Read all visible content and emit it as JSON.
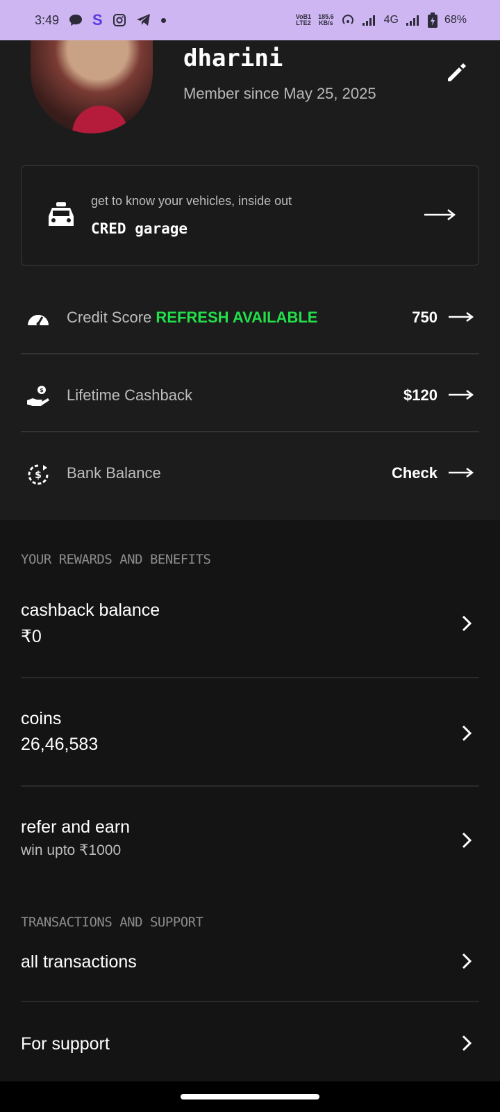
{
  "status": {
    "time": "3:49",
    "volte": "VoB1\nLTE2",
    "speed": "185.6\nKB/s",
    "network": "4G",
    "battery": "68%"
  },
  "profile": {
    "name": "dharini",
    "member_since": "Member since May 25, 2025"
  },
  "garage": {
    "subtitle": "get to know your vehicles, inside out",
    "title": "CRED garage"
  },
  "stats": [
    {
      "label": "Credit Score",
      "tag": "REFRESH AVAILABLE",
      "value": "750"
    },
    {
      "label": "Lifetime Cashback",
      "value": "$120"
    },
    {
      "label": "Bank Balance",
      "value": "Check"
    }
  ],
  "rewards": {
    "heading": "YOUR REWARDS AND BENEFITS",
    "cashback_title": "cashback balance",
    "cashback_value": "₹0",
    "coins_title": "coins",
    "coins_value": "26,46,583",
    "refer_title": "refer and earn",
    "refer_sub": "win upto ₹1000"
  },
  "support": {
    "heading": "TRANSACTIONS AND SUPPORT",
    "transactions": "all transactions",
    "support": "For support"
  }
}
